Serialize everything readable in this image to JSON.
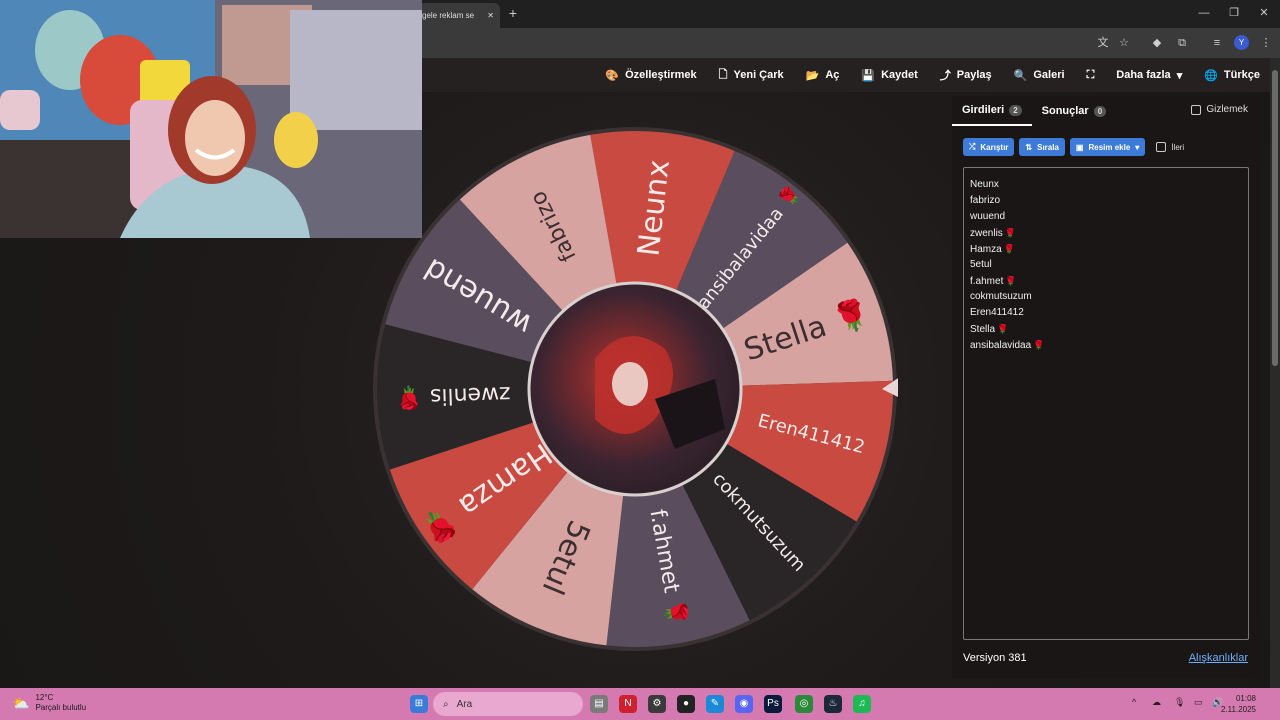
{
  "browser": {
    "tab_title": "gele reklam se",
    "tab_close": "✕",
    "new_tab": "+",
    "window_controls": [
      "—",
      "❐",
      "✕"
    ],
    "profile_initial": "Y"
  },
  "toolbar": {
    "customize": "Özelleştirmek",
    "new_wheel": "Yeni Çark",
    "open": "Aç",
    "save": "Kaydet",
    "share": "Paylaş",
    "gallery": "Galeri",
    "more": "Daha fazla",
    "language": "Türkçe"
  },
  "wheel": {
    "segments": [
      {
        "label": "Neunx",
        "color": "#c84a40",
        "emoji": ""
      },
      {
        "label": "ansibalavidaa",
        "color": "#5a4e5e",
        "emoji": "🌹"
      },
      {
        "label": "Stella",
        "color": "#d7a3a0",
        "emoji": "🌹"
      },
      {
        "label": "Eren411412",
        "color": "#c84a40",
        "emoji": ""
      },
      {
        "label": "cokmutsuzum",
        "color": "#2a2628",
        "emoji": ""
      },
      {
        "label": "f.ahmet",
        "color": "#5a4e5e",
        "emoji": "🌹"
      },
      {
        "label": "5etul",
        "color": "#d7a3a0",
        "emoji": ""
      },
      {
        "label": "Hamza",
        "color": "#c84a40",
        "emoji": "🌹"
      },
      {
        "label": "zwenlis",
        "color": "#2a2628",
        "emoji": "🌹"
      },
      {
        "label": "wuuend",
        "color": "#5a4e5e",
        "emoji": ""
      },
      {
        "label": "fabrizo",
        "color": "#d7a3a0",
        "emoji": ""
      }
    ]
  },
  "panel": {
    "tab_entries": "Girdileri",
    "tab_entries_count": "2",
    "tab_results": "Sonuçlar",
    "tab_results_count": "0",
    "hide_label": "Gizlemek",
    "shuffle": "Karıştır",
    "sort": "Sırala",
    "add_image": "Resim ekle",
    "advanced": "İleri",
    "entries": [
      {
        "name": "Neunx",
        "emoji": ""
      },
      {
        "name": "fabrizo",
        "emoji": ""
      },
      {
        "name": "wuuend",
        "emoji": ""
      },
      {
        "name": "zwenlis",
        "emoji": "🌹"
      },
      {
        "name": "Hamza",
        "emoji": "🌹"
      },
      {
        "name": "5etul",
        "emoji": ""
      },
      {
        "name": "f.ahmet",
        "emoji": "🌹"
      },
      {
        "name": "cokmutsuzum",
        "emoji": ""
      },
      {
        "name": "Eren411412",
        "emoji": ""
      },
      {
        "name": "Stella",
        "emoji": "🌹"
      },
      {
        "name": "ansibalavidaa",
        "emoji": "🌹"
      }
    ],
    "version": "Versiyon 381",
    "habits": "Alışkanlıklar"
  },
  "taskbar": {
    "temp": "12°C",
    "weather": "Parçalı bulutlu",
    "search": "Ara",
    "time": "01:08",
    "date": "2.11.2025"
  }
}
